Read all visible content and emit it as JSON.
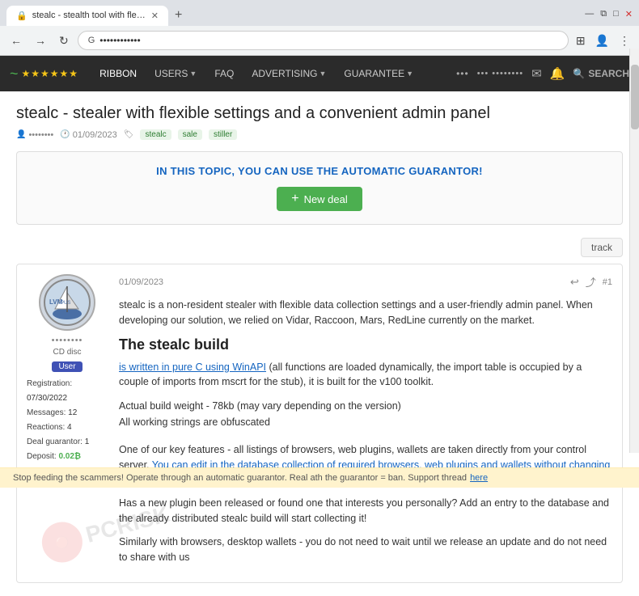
{
  "browser": {
    "tab": {
      "title": "stealc - stealth tool with flexible",
      "favicon": "🔒"
    },
    "address": "••••••••••••",
    "actions": {
      "extensions": "⊞",
      "profile": "👤",
      "menu": "⋮"
    },
    "window_controls": {
      "minimize": "—",
      "maximize": "□",
      "close": "✕",
      "restore": "⧉"
    }
  },
  "nav": {
    "logo_icon": "~",
    "logo_stars": "★★★★★★",
    "links": [
      {
        "label": "RIBBON",
        "has_dropdown": false
      },
      {
        "label": "USERS",
        "has_dropdown": true
      },
      {
        "label": "FAQ",
        "has_dropdown": false
      },
      {
        "label": "ADVERTISING",
        "has_dropdown": true
      },
      {
        "label": "GUARANTEE",
        "has_dropdown": true
      }
    ],
    "user_dots": "••• ••••••••",
    "icons": {
      "mail": "✉",
      "bell": "🔔"
    },
    "search_label": "SEARCH"
  },
  "page": {
    "title": "stealc - stealer with flexible settings and a convenient admin panel",
    "meta": {
      "author": "••••••••",
      "date": "01/09/2023",
      "tags": [
        "stealc",
        "sale",
        "stiller"
      ]
    },
    "guarantor": {
      "title": "IN THIS TOPIC, YOU CAN USE THE AUTOMATIC GUARANTOR!",
      "button_label": "New deal"
    },
    "track_label": "track",
    "post": {
      "date": "01/09/2023",
      "number": "#1",
      "author": {
        "name": "••••••••",
        "role": "CD disc",
        "badge": "User",
        "stats": [
          {
            "label": "Registration:",
            "value": "07/30/2022"
          },
          {
            "label": "Messages:",
            "value": "12"
          },
          {
            "label": "Reactions:",
            "value": "4"
          },
          {
            "label": "Deal guarantor:",
            "value": "1"
          },
          {
            "label": "Deposit:",
            "value": "0.02₿"
          }
        ]
      },
      "body": {
        "intro": "stealc is a non-resident stealer with flexible data collection settings and a user-friendly admin panel. When developing our solution, we relied on Vidar, Raccoon, Mars, RedLine currently on the market.",
        "heading": "The stealc build",
        "link1": "is written in pure C using WinAPI",
        "text1": " (all functions are loaded dynamically, the import table is occupied by a couple of imports from mscrt for the stub), it is built for the v100 toolkit.",
        "text2": "Actual build weight - 78kb (may vary depending on the version)",
        "text3": "All working strings are obfuscated",
        "para2": "One of our key features - all listings of browsers, web plugins, wallets are taken directly from your control server. ",
        "link2": "You can edit in the database collection of required browsers, web plugins and wallets without changing the stealer build",
        "text4": ".",
        "para3": "Has a new plugin been released or found one that interests you personally? Add an entry to the database and the already distributed stealc build will start collecting it!",
        "para4": "Similarly with browsers, desktop wallets - you do not need to wait until we release an update and do not need to share with us"
      }
    }
  },
  "warning": {
    "text": "Stop feeding the scammers! Operate through an automatic guarantor. Real ath the guarantor = ban. Support thread ",
    "link_label": "here"
  }
}
